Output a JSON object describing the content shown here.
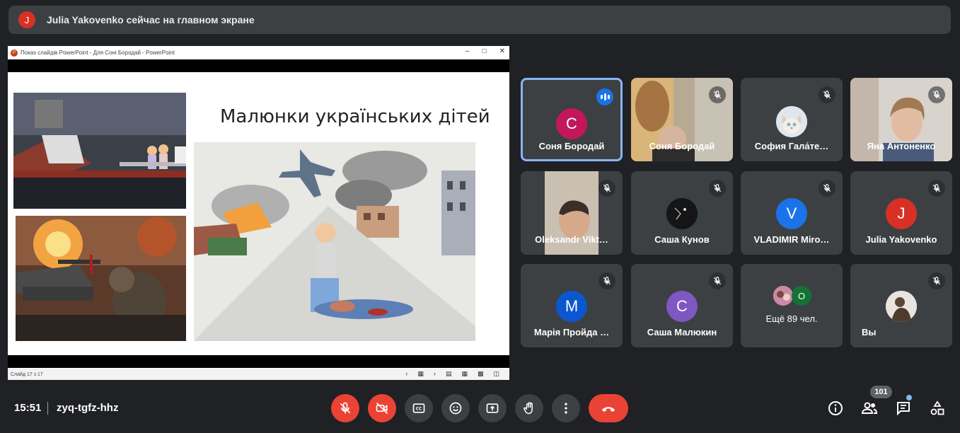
{
  "banner": {
    "avatar_letter": "J",
    "text": "Julia Yakovenko сейчас на главном экране"
  },
  "presentation": {
    "window_title": "Показ слайдів PowerPoint  -  Для Соні Бородай - PowerPoint",
    "slide_title": "Малюнки українських дітей",
    "status": "Слайд 17 з 17"
  },
  "tiles": [
    {
      "name": "Соня Бородай",
      "letter": "С",
      "color": "#c2185b",
      "speaking": true
    },
    {
      "name": "Соня Бородай",
      "muted": true
    },
    {
      "name": "София Гала́те…",
      "muted": true
    },
    {
      "name": "Яна Антоненко",
      "muted": true
    },
    {
      "name": "Oleksandr Vikt…",
      "muted": true
    },
    {
      "name": "Саша Кунов",
      "muted": true
    },
    {
      "name": "VLADIMIR Miro…",
      "letter": "V",
      "color": "#1a73e8",
      "muted": true
    },
    {
      "name": "Julia Yakovenko",
      "letter": "J",
      "color": "#d93025",
      "muted": true
    },
    {
      "name": "Марія Пройда …",
      "letter": "M",
      "color": "#0b57d0",
      "muted": true
    },
    {
      "name": "Саша Малюкин",
      "letter": "С",
      "color": "#7e57c2",
      "muted": true
    },
    {
      "name": "Ещё 89 чел.",
      "stack_letter": "O"
    },
    {
      "name": "Вы",
      "muted": true
    }
  ],
  "bottom": {
    "time": "15:51",
    "meeting_code": "zyq-tgfz-hhz",
    "participant_count": "101"
  }
}
